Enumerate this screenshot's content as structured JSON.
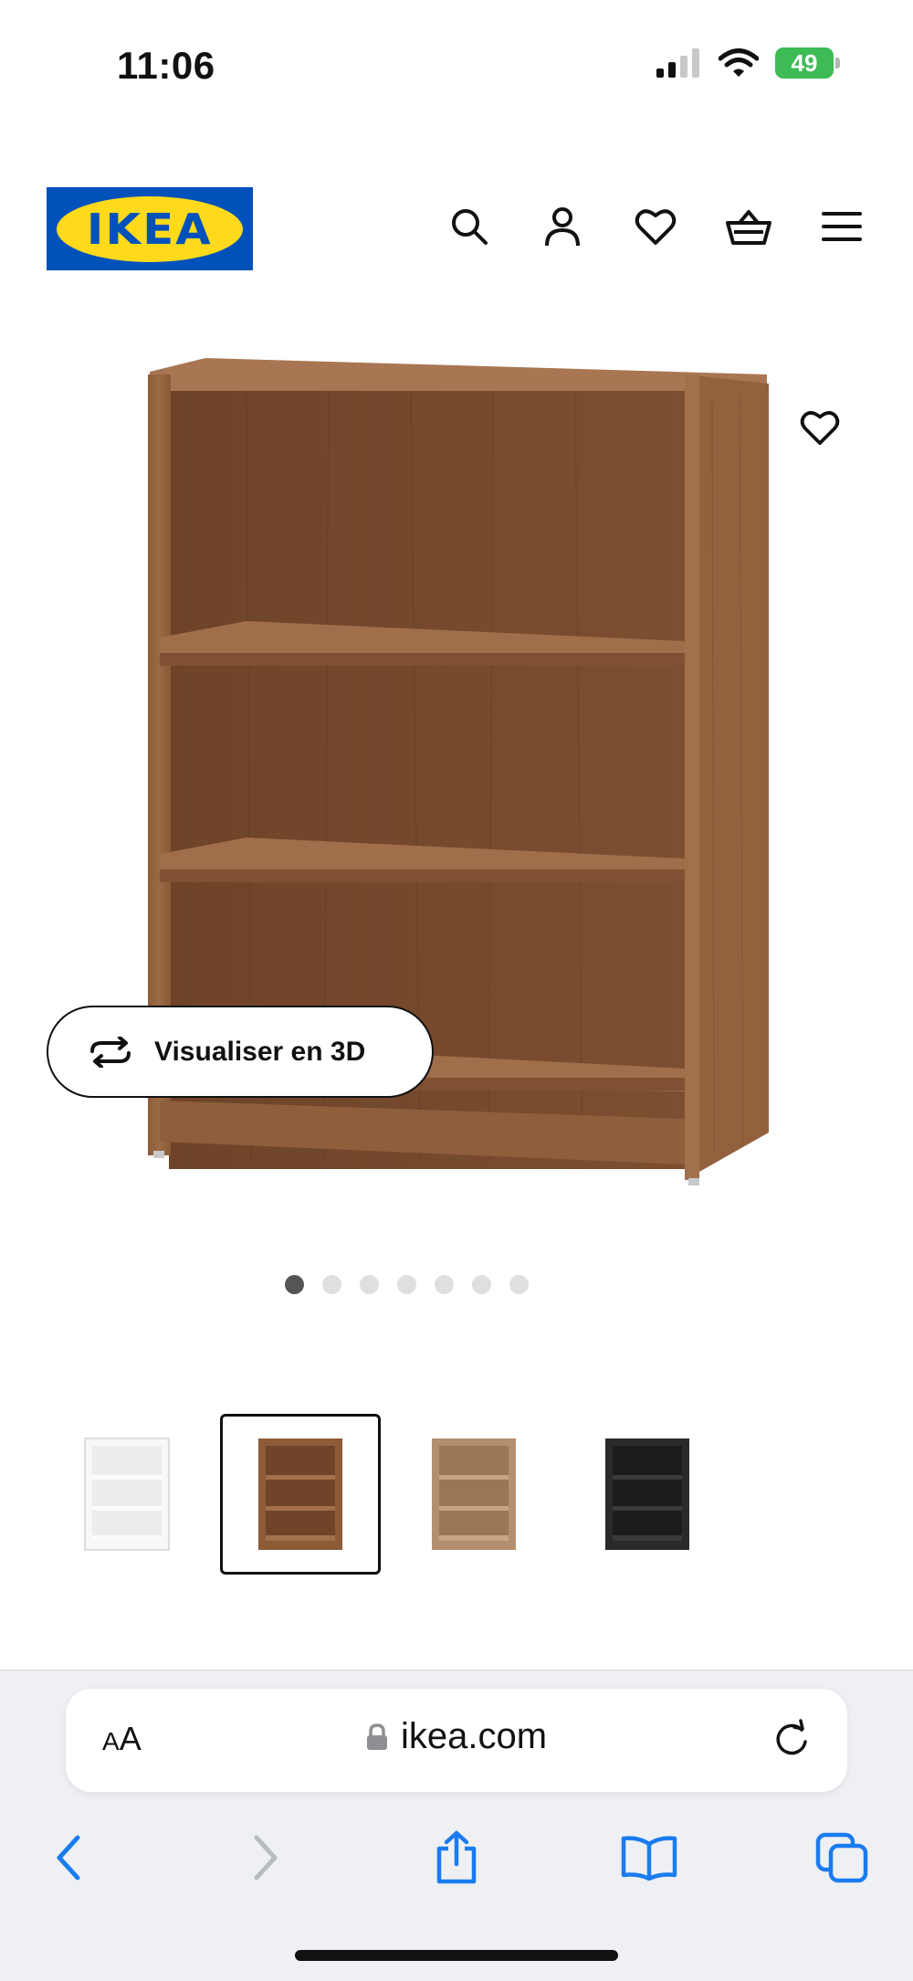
{
  "status_bar": {
    "time": "11:06",
    "battery": "49"
  },
  "header": {
    "logo_text": "IKEA",
    "icons": [
      "search-icon",
      "account-icon",
      "heart-icon",
      "basket-icon",
      "menu-icon"
    ]
  },
  "product": {
    "visualise_3d_label": "Visualiser en 3D",
    "image_count": 7,
    "active_image": 1,
    "variants": [
      {
        "color": "#f4f4f2",
        "name": "white"
      },
      {
        "color": "#8a5a38",
        "name": "brown walnut effect",
        "selected": true
      },
      {
        "color": "#b48f6f",
        "name": "oak effect"
      },
      {
        "color": "#2a2a2a",
        "name": "black-brown"
      }
    ]
  },
  "browser": {
    "aa_label_small": "A",
    "aa_label_large": "A",
    "url": "ikea.com"
  },
  "colors": {
    "ikea_blue": "#0051ba",
    "ikea_yellow": "#ffda1a",
    "ios_blue": "#1a7cf0",
    "battery_green": "#3dbb55"
  }
}
